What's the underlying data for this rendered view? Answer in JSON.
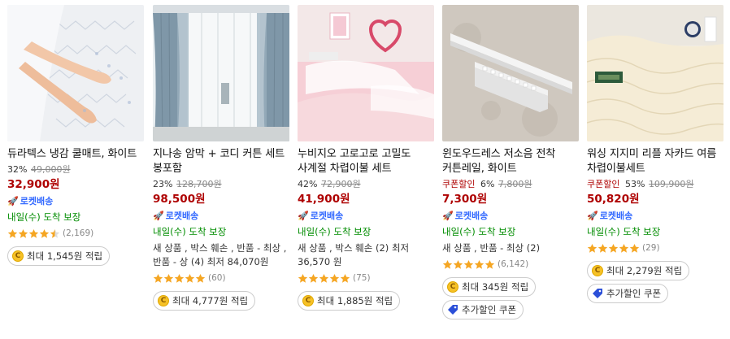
{
  "products": [
    {
      "title": "듀라텍스 냉감 쿨매트, 화이트",
      "coupon": "",
      "discount": "32%",
      "original_price": "49,000원",
      "price": "32,900원",
      "rocket": "로켓배송",
      "delivery": "내일(수) 도착 보장",
      "used": "",
      "rating": 4.5,
      "reviews": "(2,169)",
      "pills": [
        {
          "icon": "coin-icon",
          "text": "최대 1,545원 적립"
        }
      ]
    },
    {
      "title": "지나송 암막 + 코디 커튼 세트 봉포함",
      "coupon": "",
      "discount": "23%",
      "original_price": "128,700원",
      "price": "98,500원",
      "rocket": "로켓배송",
      "delivery": "내일(수) 도착 보장",
      "used": "새 상품 , 박스 훼손 , 반품 - 최상 , 반품 - 상 (4) 최저 84,070원",
      "rating": 5,
      "reviews": "(60)",
      "pills": [
        {
          "icon": "coin-icon",
          "text": "최대 4,777원 적립"
        }
      ]
    },
    {
      "title": "누비지오 고로고로 고밀도 사계절 차렵이불 세트",
      "coupon": "",
      "discount": "42%",
      "original_price": "72,900원",
      "price": "41,900원",
      "rocket": "로켓배송",
      "delivery": "내일(수) 도착 보장",
      "used": "새 상품 , 박스 훼손 (2) 최저 36,570 원",
      "rating": 5,
      "reviews": "(75)",
      "pills": [
        {
          "icon": "coin-icon",
          "text": "최대 1,885원 적립"
        }
      ]
    },
    {
      "title": "윈도우드레스 저소음 전착 커튼레일, 화이트",
      "coupon": "쿠폰할인",
      "discount": "6%",
      "original_price": "7,800원",
      "price": "7,300원",
      "rocket": "로켓배송",
      "delivery": "내일(수) 도착 보장",
      "used": "새 상품 , 반품 - 최상 (2)",
      "rating": 5,
      "reviews": "(6,142)",
      "pills": [
        {
          "icon": "coin-icon",
          "text": "최대 345원 적립"
        },
        {
          "icon": "coupon-tag-icon",
          "text": "추가할인 쿠폰"
        }
      ]
    },
    {
      "title": "워싱 지지미 리플 자카드 여름 차렵이불세트",
      "coupon": "쿠폰할인",
      "discount": "53%",
      "original_price": "109,900원",
      "price": "50,820원",
      "rocket": "로켓배송",
      "delivery": "내일(수) 도착 보장",
      "used": "",
      "rating": 5,
      "reviews": "(29)",
      "pills": [
        {
          "icon": "coin-icon",
          "text": "최대 2,279원 적립"
        },
        {
          "icon": "coupon-tag-icon",
          "text": "추가할인 쿠폰"
        }
      ]
    }
  ],
  "colors": {
    "price": "#ae0000",
    "rocket": "#346aff",
    "delivery": "#008c00",
    "star": "#f5a623"
  }
}
